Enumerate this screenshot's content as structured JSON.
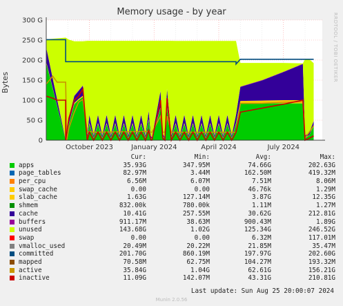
{
  "title": "Memory usage - by year",
  "y_axis_label": "Bytes",
  "watermark": "RRDTOOL / TOBI OETIKER",
  "last_update": "Last update: Sun Aug 25 20:00:07 2024",
  "footer": "Munin 2.0.56",
  "legend": {
    "headers": [
      "Cur:",
      "Min:",
      "Avg:",
      "Max:"
    ],
    "rows": [
      {
        "name": "apps",
        "color": "#00cc00",
        "cur": "35.93G",
        "min": "347.95M",
        "avg": "74.66G",
        "max": "202.63G"
      },
      {
        "name": "page_tables",
        "color": "#0066b3",
        "cur": "82.97M",
        "min": "3.44M",
        "avg": "162.50M",
        "max": "419.32M"
      },
      {
        "name": "per_cpu",
        "color": "#ff8000",
        "cur": "6.56M",
        "min": "6.07M",
        "avg": "7.51M",
        "max": "8.06M"
      },
      {
        "name": "swap_cache",
        "color": "#ffcc00",
        "cur": "0.00",
        "min": "0.00",
        "avg": "46.76k",
        "max": "1.29M"
      },
      {
        "name": "slab_cache",
        "color": "#ffcc00",
        "cur": "1.63G",
        "min": "127.14M",
        "avg": "3.87G",
        "max": "12.35G"
      },
      {
        "name": "shmem",
        "color": "#008f00",
        "cur": "832.00k",
        "min": "780.00k",
        "avg": "1.11M",
        "max": "1.27M"
      },
      {
        "name": "cache",
        "color": "#330099",
        "cur": "10.41G",
        "min": "257.55M",
        "avg": "30.62G",
        "max": "212.81G"
      },
      {
        "name": "buffers",
        "color": "#990099",
        "cur": "911.17M",
        "min": "38.63M",
        "avg": "900.43M",
        "max": "1.89G"
      },
      {
        "name": "unused",
        "color": "#ccff00",
        "cur": "143.68G",
        "min": "1.02G",
        "avg": "125.34G",
        "max": "246.52G"
      },
      {
        "name": "swap",
        "color": "#ff0000",
        "cur": "0.00",
        "min": "0.00",
        "avg": "6.32M",
        "max": "117.01M"
      },
      {
        "name": "vmalloc_used",
        "color": "#808080",
        "cur": "20.49M",
        "min": "20.22M",
        "avg": "21.85M",
        "max": "35.47M"
      },
      {
        "name": "committed",
        "color": "#004d80",
        "cur": "201.70G",
        "min": "860.19M",
        "avg": "197.97G",
        "max": "202.60G"
      },
      {
        "name": "mapped",
        "color": "#8c4d00",
        "cur": "70.58M",
        "min": "62.75M",
        "avg": "104.27M",
        "max": "193.32M"
      },
      {
        "name": "active",
        "color": "#c89600",
        "cur": "35.84G",
        "min": "1.04G",
        "avg": "62.61G",
        "max": "156.21G"
      },
      {
        "name": "inactive",
        "color": "#cc0000",
        "cur": "11.09G",
        "min": "142.07M",
        "avg": "43.31G",
        "max": "210.81G"
      }
    ]
  },
  "chart_data": {
    "type": "area",
    "x_unit": "months since 2023-08-01",
    "xlim": [
      0,
      12.8
    ],
    "ylim": [
      0,
      300
    ],
    "y_unit": "G",
    "yticks": [
      "0",
      "50 G",
      "100 G",
      "150 G",
      "200 G",
      "250 G",
      "300 G"
    ],
    "ytick_values": [
      0,
      50,
      100,
      150,
      200,
      250,
      300
    ],
    "xticks": [
      "October 2023",
      "January 2024",
      "April 2024",
      "July 2024"
    ],
    "xtick_positions": [
      2.0,
      5.0,
      8.0,
      11.0
    ],
    "grid": true,
    "stacked_series": [
      {
        "name": "apps",
        "color": "#00cc00",
        "x": [
          0,
          0.9,
          0.9,
          1.05,
          1.3,
          1.5,
          1.7,
          1.9,
          2.0,
          2.2,
          2.4,
          2.6,
          2.8,
          3.0,
          3.2,
          3.4,
          3.6,
          3.8,
          4.0,
          4.2,
          4.4,
          4.6,
          4.75,
          4.85,
          4.9,
          5.3,
          5.4,
          5.5,
          5.6,
          5.8,
          6.0,
          6.2,
          6.4,
          6.6,
          6.8,
          7.0,
          7.2,
          7.4,
          7.6,
          7.8,
          8.0,
          8.2,
          8.4,
          8.6,
          8.8,
          9.0,
          10.0,
          11.0,
          11.9,
          12.0,
          12.2,
          12.4
        ],
        "y": [
          193,
          193,
          0,
          40,
          90,
          100,
          108,
          5,
          40,
          5,
          40,
          5,
          40,
          5,
          40,
          5,
          40,
          5,
          40,
          5,
          40,
          5,
          50,
          5,
          3,
          80,
          10,
          3,
          80,
          5,
          40,
          5,
          40,
          5,
          40,
          5,
          40,
          5,
          40,
          5,
          40,
          5,
          40,
          5,
          40,
          92,
          92,
          92,
          92,
          5,
          12,
          36
        ]
      },
      {
        "name": "slab_cache",
        "color": "#ffcc00",
        "x": [
          0,
          0.9,
          0.9,
          1.05,
          1.3,
          1.5,
          1.7,
          1.9,
          2.0,
          2.2,
          2.4,
          2.6,
          2.8,
          3.0,
          3.2,
          3.4,
          3.6,
          3.8,
          4.0,
          4.2,
          4.4,
          4.6,
          4.75,
          4.85,
          4.9,
          5.3,
          5.4,
          5.5,
          5.6,
          5.8,
          6.0,
          6.2,
          6.4,
          6.6,
          6.8,
          7.0,
          7.2,
          7.4,
          7.6,
          7.8,
          8.0,
          8.2,
          8.4,
          8.6,
          8.8,
          9.0,
          10.0,
          11.0,
          11.9,
          12.0,
          12.2,
          12.4
        ],
        "y": [
          3,
          3,
          0,
          2,
          3,
          3,
          3,
          1,
          3,
          1,
          3,
          1,
          3,
          1,
          3,
          1,
          3,
          1,
          3,
          1,
          3,
          1,
          3,
          1,
          1,
          3,
          1,
          1,
          3,
          1,
          3,
          1,
          3,
          1,
          3,
          1,
          3,
          1,
          3,
          1,
          3,
          1,
          3,
          1,
          3,
          6,
          7,
          8,
          8,
          1,
          1,
          1.6
        ]
      },
      {
        "name": "cache",
        "color": "#330099",
        "x": [
          0,
          0.9,
          0.9,
          1.05,
          1.3,
          1.5,
          1.7,
          1.9,
          2.0,
          2.2,
          2.4,
          2.6,
          2.8,
          3.0,
          3.2,
          3.4,
          3.6,
          3.8,
          4.0,
          4.2,
          4.4,
          4.6,
          4.75,
          4.85,
          4.9,
          5.3,
          5.4,
          5.5,
          5.6,
          5.8,
          6.0,
          6.2,
          6.4,
          6.6,
          6.8,
          7.0,
          7.2,
          7.4,
          7.6,
          7.8,
          8.0,
          8.2,
          8.4,
          8.6,
          8.8,
          9.0,
          10.0,
          11.0,
          11.9,
          12.0,
          12.2,
          12.4
        ],
        "y": [
          35,
          35,
          0,
          15,
          17,
          20,
          25,
          5,
          20,
          5,
          20,
          5,
          20,
          5,
          20,
          5,
          20,
          5,
          20,
          5,
          20,
          5,
          20,
          5,
          2,
          40,
          5,
          2,
          45,
          5,
          20,
          5,
          20,
          5,
          20,
          5,
          20,
          5,
          20,
          5,
          20,
          5,
          20,
          5,
          20,
          35,
          50,
          70,
          90,
          5,
          6,
          10
        ]
      },
      {
        "name": "buffers",
        "color": "#990099",
        "x": [
          0,
          12.4
        ],
        "y": [
          1,
          0.9
        ]
      },
      {
        "name": "unused",
        "color": "#ccff00",
        "x": [
          0,
          0.9,
          0.9,
          1.05,
          1.3,
          1.5,
          1.7,
          1.9,
          2.0,
          2.2,
          2.4,
          2.6,
          2.8,
          3.0,
          3.2,
          3.4,
          3.6,
          3.8,
          4.0,
          4.2,
          4.4,
          4.6,
          4.75,
          4.85,
          4.9,
          5.3,
          5.4,
          5.5,
          5.6,
          5.8,
          6.0,
          6.2,
          6.4,
          6.6,
          6.8,
          7.0,
          7.2,
          7.4,
          7.6,
          7.8,
          8.0,
          8.2,
          8.4,
          8.6,
          8.8,
          9.0,
          10.0,
          11.0,
          11.9,
          12.0,
          12.2,
          12.4
        ],
        "y": [
          20,
          20,
          255,
          193,
          136,
          123,
          110,
          236,
          184,
          236,
          184,
          236,
          184,
          236,
          184,
          236,
          184,
          236,
          184,
          236,
          184,
          236,
          174,
          236,
          241,
          124,
          231,
          241,
          119,
          236,
          184,
          236,
          184,
          236,
          184,
          236,
          184,
          236,
          184,
          236,
          184,
          236,
          184,
          236,
          184,
          59,
          43,
          22,
          1,
          191,
          182,
          144
        ]
      }
    ],
    "line_series": [
      {
        "name": "committed",
        "color": "#004d80",
        "x": [
          0,
          0.9,
          0.9,
          8.8,
          8.8,
          9.0,
          12.4
        ],
        "y": [
          251,
          251,
          196,
          196,
          190,
          202,
          202
        ]
      },
      {
        "name": "active",
        "color": "#c89600",
        "x": [
          0,
          0.3,
          0.5,
          0.9,
          0.95,
          1.05,
          1.3,
          1.5,
          1.7,
          1.9,
          2.0,
          2.2,
          4.75,
          4.85,
          4.9,
          5.3,
          5.4,
          5.5,
          5.6,
          5.8,
          8.8,
          9.0,
          10.0,
          11.0,
          11.9,
          12.0,
          12.4
        ],
        "y": [
          140,
          160,
          145,
          145,
          0,
          30,
          70,
          95,
          102,
          20,
          22,
          20,
          22,
          20,
          20,
          60,
          20,
          20,
          60,
          20,
          20,
          92,
          92,
          95,
          96,
          5,
          36
        ]
      },
      {
        "name": "inactive",
        "color": "#cc0000",
        "x": [
          0,
          0.3,
          0.5,
          0.9,
          0.9,
          1.05,
          1.3,
          1.5,
          1.7,
          1.9,
          2.0,
          2.2,
          2.4,
          2.6,
          2.8,
          3.0,
          3.2,
          3.4,
          3.6,
          3.8,
          4.0,
          4.2,
          4.4,
          4.6,
          4.75,
          4.85,
          4.9,
          5.3,
          5.4,
          5.5,
          5.6,
          5.8,
          6.0,
          6.2,
          6.4,
          6.6,
          6.8,
          7.0,
          7.2,
          7.4,
          7.6,
          7.8,
          8.0,
          8.2,
          8.4,
          8.6,
          8.8,
          9.0,
          10.0,
          11.0,
          11.9,
          12.0,
          12.2,
          12.4
        ],
        "y": [
          110,
          105,
          100,
          100,
          0,
          55,
          100,
          110,
          128,
          0,
          20,
          0,
          20,
          0,
          20,
          0,
          20,
          0,
          20,
          0,
          20,
          0,
          20,
          0,
          25,
          0,
          0,
          100,
          5,
          0,
          105,
          0,
          20,
          0,
          20,
          0,
          20,
          0,
          20,
          0,
          20,
          0,
          20,
          0,
          20,
          0,
          20,
          70,
          80,
          90,
          100,
          0,
          5,
          11
        ]
      }
    ]
  }
}
